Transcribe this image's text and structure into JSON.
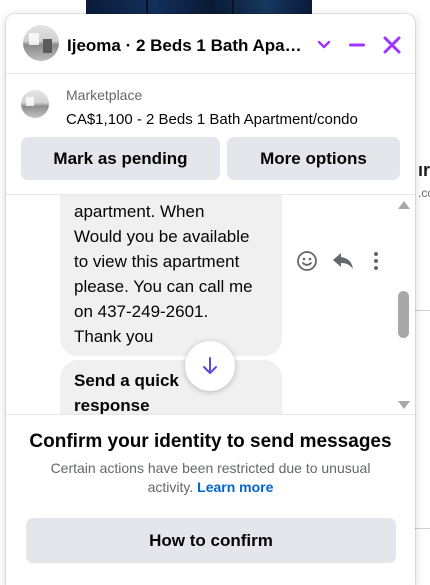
{
  "colors": {
    "accent": "#a033ff",
    "link": "#0064d1",
    "button_bg": "#e4e6eb",
    "bubble_bg": "#f0f0f0",
    "secondary_text": "#65676b"
  },
  "background": {
    "partial_text_1": "ır",
    "partial_text_2": ".cc"
  },
  "header": {
    "avatar_icon": "house-photo-avatar",
    "title": "Ijeoma · 2 Beds 1 Bath Apa…",
    "icons": [
      "chevron-down-icon",
      "minimize-icon",
      "close-icon"
    ]
  },
  "listing": {
    "thumbnail_icon": "house-photo-thumbnail",
    "source": "Marketplace",
    "title": "CA$1,100 - 2 Beds 1 Bath Apartment/condo",
    "buttons": {
      "pending": "Mark as pending",
      "more": "More options"
    }
  },
  "messages": {
    "main_text": "apartment. When\nWould you be available\nto view this apartment\nplease. You can call me\non 437-249-2601.\nThank you",
    "quick_text": "Send a quick\nresponse",
    "actions": [
      "smiley-face-icon",
      "reply-icon",
      "more-vertical-icon"
    ],
    "scroll_down_icon": "arrow-down-icon"
  },
  "notice": {
    "title": "Confirm your identity to send messages",
    "body": "Certain actions have been restricted due to unusual activity.",
    "link": "Learn more",
    "button": "How to confirm"
  }
}
